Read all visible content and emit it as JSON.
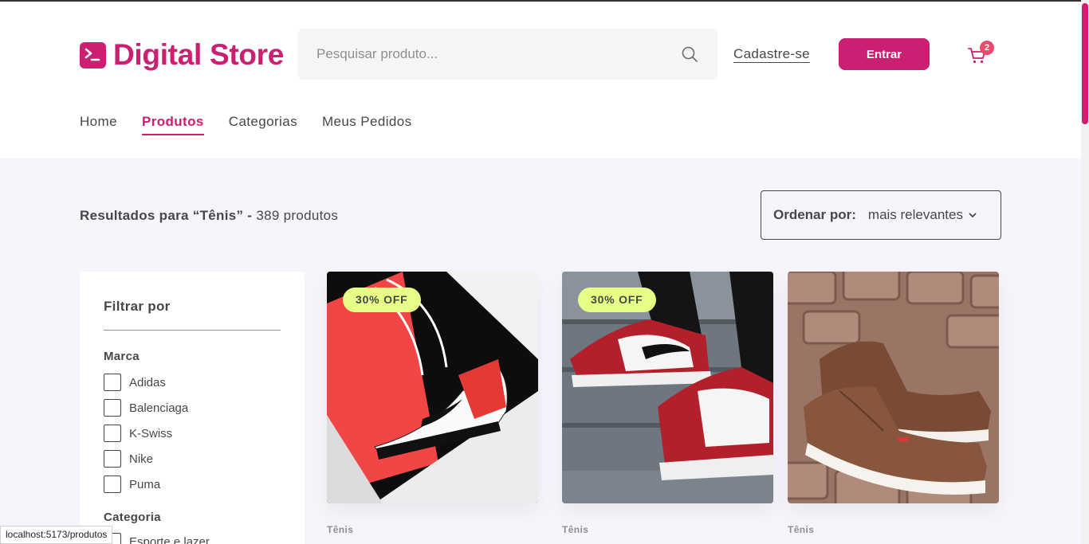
{
  "header": {
    "brand": "Digital Store",
    "search_placeholder": "Pesquisar produto...",
    "signup_label": "Cadastre-se",
    "login_label": "Entrar",
    "cart_count": "2",
    "accent_color": "#c92071"
  },
  "nav": {
    "items": [
      {
        "label": "Home",
        "active": false
      },
      {
        "label": "Produtos",
        "active": true
      },
      {
        "label": "Categorias",
        "active": false
      },
      {
        "label": "Meus Pedidos",
        "active": false
      }
    ]
  },
  "results": {
    "prefix": "Resultados para “Tênis” -",
    "count": "389 produtos"
  },
  "sort": {
    "label": "Ordenar por:",
    "value": "mais relevantes"
  },
  "filters": {
    "title": "Filtrar por",
    "brand_group": "Marca",
    "brands": [
      "Adidas",
      "Balenciaga",
      "K-Swiss",
      "Nike",
      "Puma"
    ],
    "category_group": "Categoria",
    "categories": [
      "Esporte e lazer"
    ]
  },
  "products": [
    {
      "badge": "30% OFF",
      "category": "Tênis"
    },
    {
      "badge": "30% OFF",
      "category": "Tênis"
    },
    {
      "badge": "",
      "category": "Tênis"
    }
  ],
  "status_url": "localhost:5173/produtos"
}
